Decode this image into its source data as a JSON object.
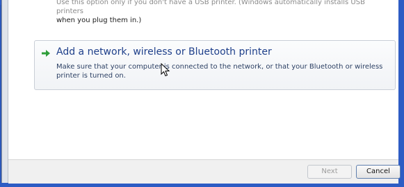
{
  "wizard": {
    "previous_option_desc_line1": "Use this option only if you don't have a USB printer. (Windows automatically installs USB printers",
    "previous_option_desc_line2": "when you plug them in.)",
    "option": {
      "title": "Add a network, wireless or Bluetooth printer",
      "description": "Make sure that your computer is connected to the network, or that your Bluetooth or wireless printer is turned on.",
      "icon": "green-arrow-icon"
    },
    "buttons": {
      "next": "Next",
      "cancel": "Cancel"
    }
  },
  "colors": {
    "accent_blue": "#1e3f8a",
    "arrow_green": "#2f9e3a",
    "desktop_blue": "#2d5cc4"
  }
}
